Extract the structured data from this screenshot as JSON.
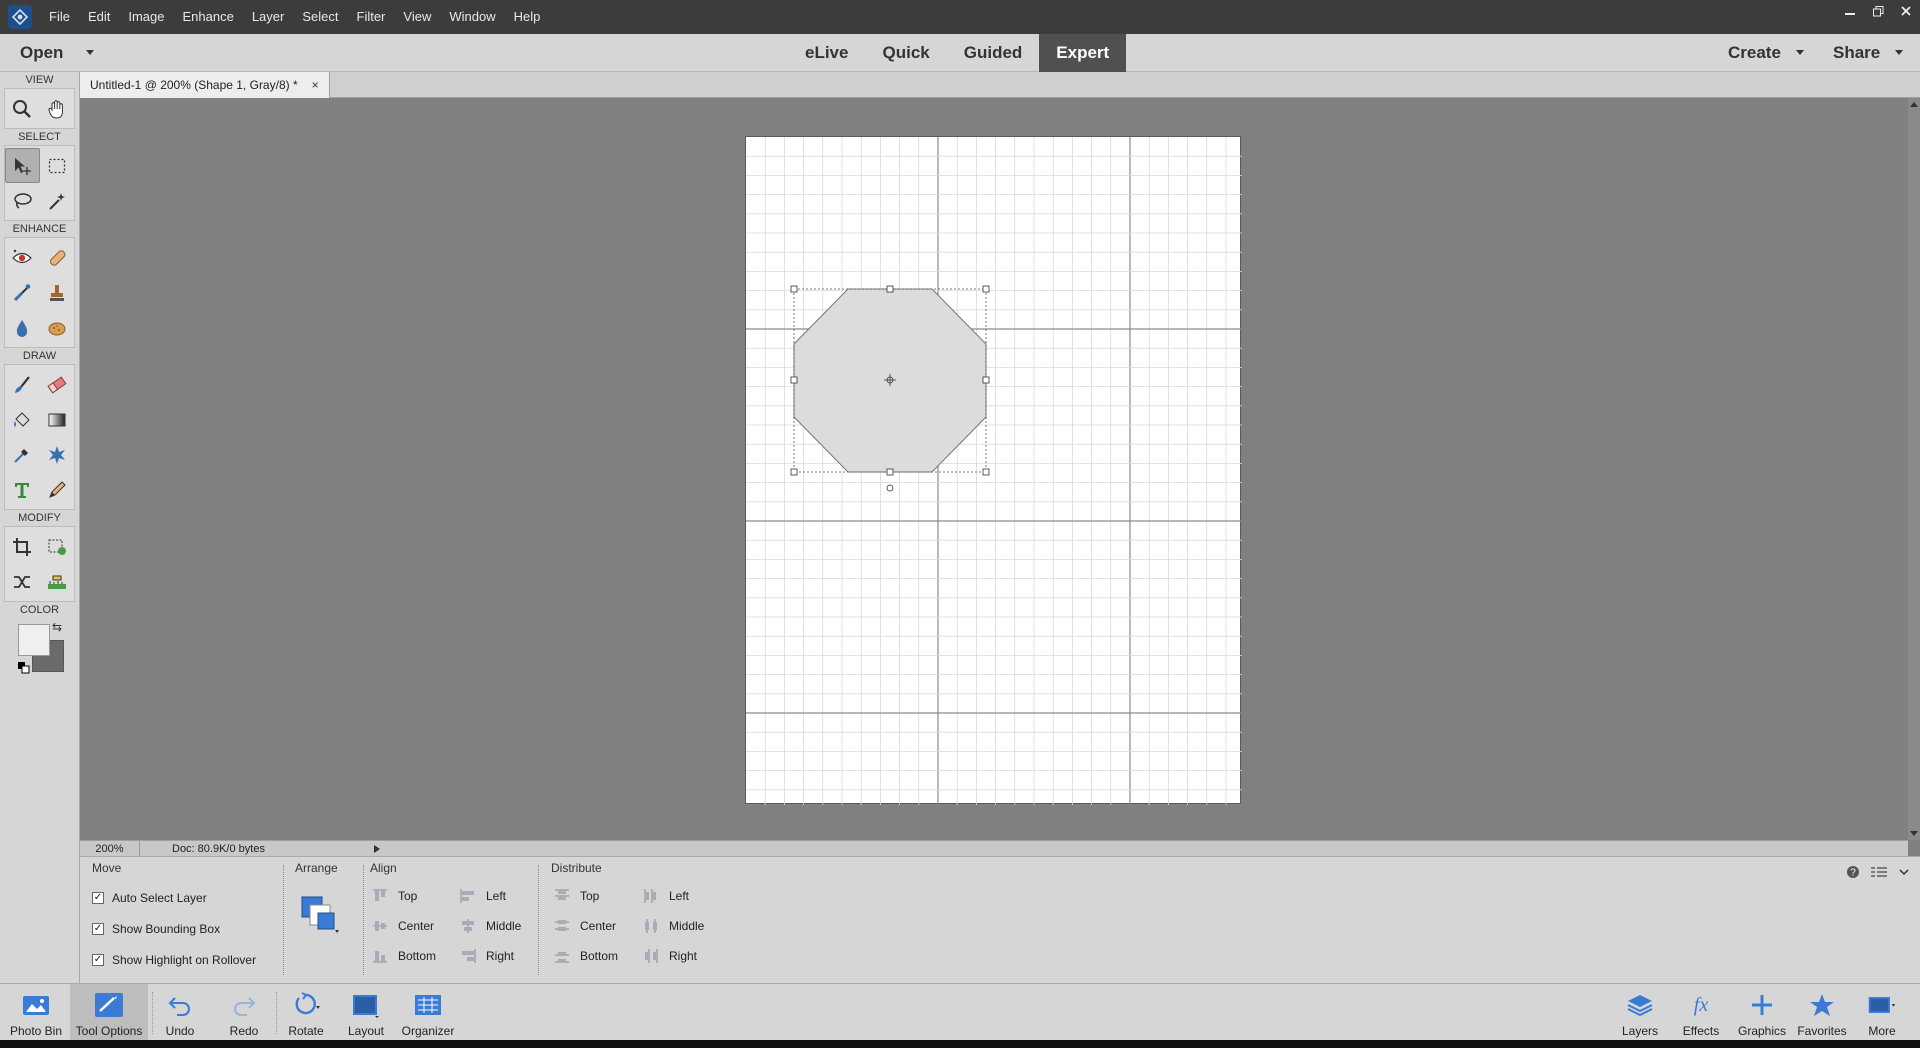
{
  "menu": {
    "items": [
      "File",
      "Edit",
      "Image",
      "Enhance",
      "Layer",
      "Select",
      "Filter",
      "View",
      "Window",
      "Help"
    ]
  },
  "modebar": {
    "open_label": "Open",
    "tabs": [
      "eLive",
      "Quick",
      "Guided",
      "Expert"
    ],
    "active_tab": "Expert",
    "create_label": "Create",
    "share_label": "Share"
  },
  "toolbox": {
    "sections": {
      "view": "VIEW",
      "select": "SELECT",
      "enhance": "ENHANCE",
      "draw": "DRAW",
      "modify": "MODIFY",
      "color": "COLOR"
    },
    "tools": {
      "view": [
        "zoom-icon",
        "hand-icon"
      ],
      "select": [
        "move-icon",
        "marquee-icon",
        "lasso-icon",
        "quick-selection-icon"
      ],
      "enhance": [
        "red-eye-icon",
        "spot-healing-icon",
        "smart-brush-icon",
        "clone-stamp-icon",
        "blur-icon",
        "sponge-icon"
      ],
      "draw": [
        "brush-icon",
        "eraser-icon",
        "paint-bucket-icon",
        "gradient-icon",
        "eyedropper-icon",
        "custom-shape-icon",
        "type-icon",
        "pencil-icon"
      ],
      "modify": [
        "crop-icon",
        "recompose-icon",
        "content-aware-move-icon",
        "straighten-icon"
      ]
    },
    "colors": {
      "foreground": "#efefef",
      "background": "#6a6a6a"
    }
  },
  "document": {
    "tab_title": "Untitled-1 @ 200% (Shape 1, Gray/8) *",
    "shape_fill": "#dcdcdc",
    "grid_color": "#d9d9d9",
    "major_grid_color": "#8a8a8a"
  },
  "status": {
    "zoom": "200%",
    "doc_size": "Doc: 80.9K/0 bytes"
  },
  "tool_options": {
    "move_label": "Move",
    "checkboxes": [
      {
        "label": "Auto Select Layer",
        "checked": true
      },
      {
        "label": "Show Bounding Box",
        "checked": true
      },
      {
        "label": "Show Highlight on Rollover",
        "checked": true
      }
    ],
    "arrange_label": "Arrange",
    "align_label": "Align",
    "align_buttons": {
      "top": "Top",
      "center": "Center",
      "bottom": "Bottom",
      "left": "Left",
      "middle": "Middle",
      "right": "Right"
    },
    "distribute_label": "Distribute",
    "distribute_buttons": {
      "top": "Top",
      "center": "Center",
      "bottom": "Bottom",
      "left": "Left",
      "middle": "Middle",
      "right": "Right"
    }
  },
  "taskbar": {
    "photo_bin": "Photo Bin",
    "tool_options": "Tool Options",
    "undo": "Undo",
    "redo": "Redo",
    "rotate": "Rotate",
    "layout": "Layout",
    "organizer": "Organizer",
    "layers": "Layers",
    "effects": "Effects",
    "graphics": "Graphics",
    "favorites": "Favorites",
    "more": "More"
  }
}
